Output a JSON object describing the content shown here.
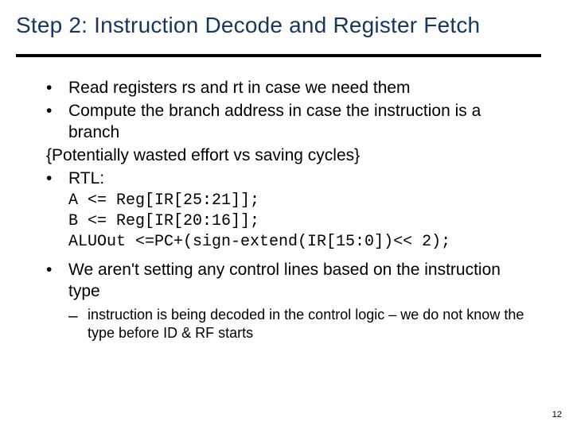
{
  "title": "Step 2:  Instruction Decode and Register Fetch",
  "bullets": {
    "b1": "Read registers rs and rt in case we need them",
    "b2": "Compute the branch address in case the instruction is a branch",
    "brace": "{Potentially wasted effort vs saving cycles}",
    "b3": "RTL:",
    "code1": "A <= Reg[IR[25:21]];",
    "code2": "B <= Reg[IR[20:16]];",
    "code3": "ALUOut <=PC+(sign-extend(IR[15:0])<< 2);",
    "b4": "We aren't setting any control lines based on the instruction type",
    "sub1": "instruction is being decoded in the control logic – we do not know the type before ID & RF starts"
  },
  "glyphs": {
    "dot": "•",
    "dash": "–"
  },
  "page": "12"
}
